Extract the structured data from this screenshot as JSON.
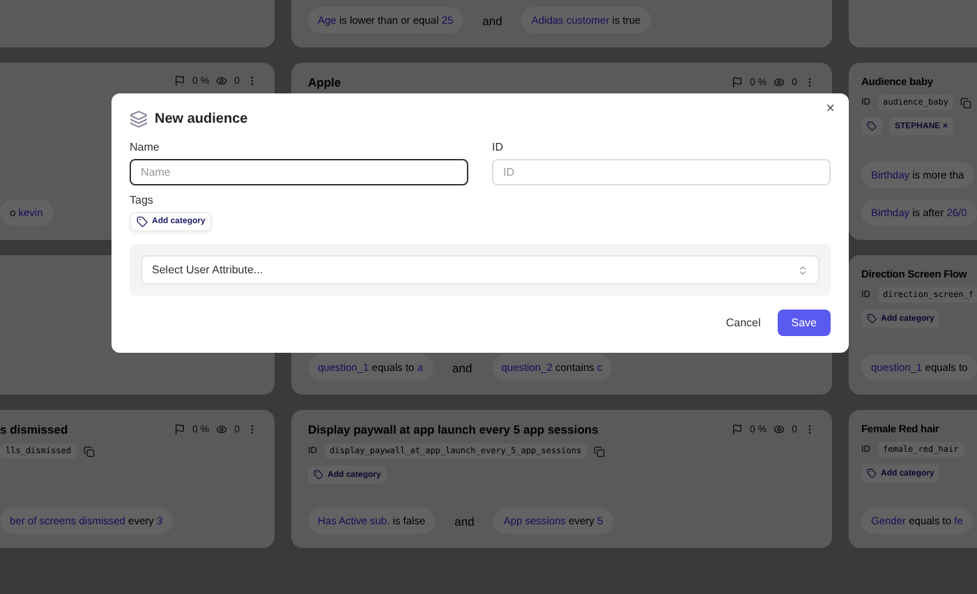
{
  "card_rows": [
    [
      {},
      {
        "conditions": [
          {
            "kind": "condition",
            "attribute": "Age",
            "operator": "is lower than or equal",
            "value": "25"
          },
          {
            "kind": "joiner",
            "text": "and"
          },
          {
            "kind": "condition",
            "attribute": "Adidas customer",
            "operator": "is true"
          }
        ]
      },
      {}
    ],
    [
      {
        "stats": {
          "percent": "0 %",
          "views": "0"
        },
        "conditions": [
          {
            "kind": "condition",
            "operator": "o",
            "value": "kevin"
          }
        ]
      },
      {
        "title": "Apple",
        "stats": {
          "percent": "0 %",
          "views": "0"
        }
      },
      {
        "title": "Audience baby",
        "id_label": "ID",
        "id_value": "audience_baby",
        "tags": [
          {
            "kind": "icon"
          },
          {
            "kind": "label",
            "label": "STEPHANE",
            "remove": "×"
          }
        ],
        "condition_rows": [
          [
            {
              "kind": "condition",
              "attribute": "Birthday",
              "operator": "is more tha"
            }
          ],
          [
            {
              "kind": "condition",
              "attribute": "Birthday",
              "operator": "is after",
              "value": "26/0"
            }
          ]
        ]
      }
    ],
    [
      {},
      {
        "conditions": [
          {
            "kind": "condition",
            "attribute": "question_1",
            "operator": "equals to",
            "value": "a"
          },
          {
            "kind": "joiner",
            "text": "and"
          },
          {
            "kind": "condition",
            "attribute": "question_2",
            "operator": "contains",
            "value": "c"
          }
        ]
      },
      {
        "title": "Direction Screen Flow",
        "id_label": "ID",
        "id_value": "direction_screen_f",
        "tags": [
          {
            "kind": "add",
            "label": "Add category"
          }
        ],
        "conditions": [
          {
            "kind": "condition",
            "attribute": "question_1",
            "operator": "equals to"
          }
        ]
      }
    ],
    [
      {
        "title": "s dismissed",
        "id_value": "lls_dismissed",
        "stats": {
          "percent": "0 %",
          "views": "0"
        },
        "conditions": [
          {
            "kind": "condition",
            "attribute": "ber of screens dismissed",
            "operator": "every",
            "value": "3"
          }
        ]
      },
      {
        "title": "Display paywall at app launch every 5 app sessions",
        "id_label": "ID",
        "id_value": "display_paywall_at_app_launch_every_5_app_sessions",
        "stats": {
          "percent": "0 %",
          "views": "0"
        },
        "tags": [
          {
            "kind": "add",
            "label": "Add category"
          }
        ],
        "conditions": [
          {
            "kind": "condition",
            "attribute": "Has Active sub.",
            "operator": "is false"
          },
          {
            "kind": "joiner",
            "text": "and"
          },
          {
            "kind": "condition",
            "attribute": "App sessions",
            "operator": "every",
            "value": "5"
          }
        ]
      },
      {
        "title": "Female Red hair",
        "id_label": "ID",
        "id_value": "female_red_hair",
        "tags": [
          {
            "kind": "add",
            "label": "Add category"
          }
        ],
        "conditions": [
          {
            "kind": "condition",
            "attribute": "Gender",
            "operator": "equals to",
            "value": "fe"
          }
        ]
      }
    ]
  ],
  "dialog": {
    "title": "New audience",
    "close": "×",
    "fields": [
      {
        "label": "Name",
        "placeholder": "Name",
        "focused": true
      },
      {
        "label": "ID",
        "placeholder": "ID",
        "focused": false
      }
    ],
    "tags_label": "Tags",
    "add_category": "Add category",
    "attribute_select": {
      "placeholder": "Select User Attribute..."
    },
    "buttons": [
      {
        "kind": "secondary",
        "label": "Cancel"
      },
      {
        "kind": "primary",
        "label": "Save"
      }
    ]
  }
}
